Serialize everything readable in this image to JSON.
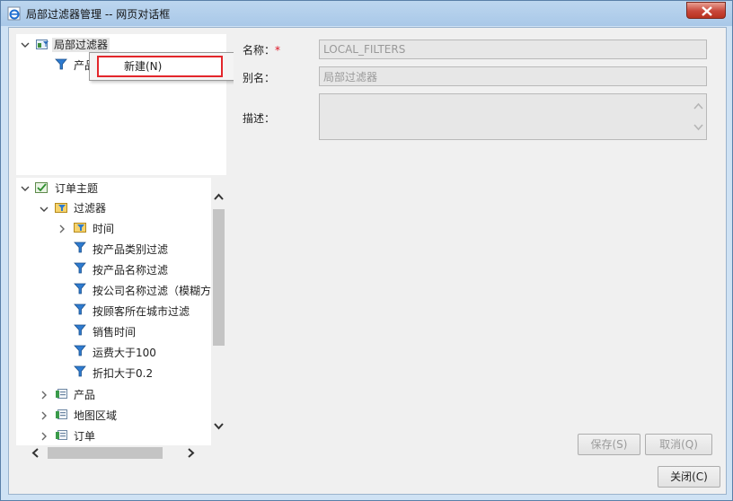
{
  "window": {
    "title": "局部过滤器管理 -- 网页对话框"
  },
  "top_tree": {
    "root_label": "局部过滤器",
    "child_label": "产品"
  },
  "context_menu": {
    "item_label": "新建(N)"
  },
  "bottom_tree": {
    "root_label": "订单主题",
    "filters_label": "过滤器",
    "items": [
      "时间",
      "按产品类别过滤",
      "按产品名称过滤",
      "按公司名称过滤（模糊方",
      "按顾客所在城市过滤",
      "销售时间",
      "运费大于100",
      "折扣大于0.2"
    ],
    "folders": [
      "产品",
      "地图区域",
      "订单"
    ]
  },
  "form": {
    "name_label": "名称：",
    "required_mark": "*",
    "name_value": "LOCAL_FILTERS",
    "alias_label": "别名：",
    "alias_value": "局部过滤器",
    "desc_label": "描述："
  },
  "buttons": {
    "save": "保存(S)",
    "cancel": "取消(Q)",
    "close": "关闭(C)"
  },
  "colors": {
    "title_bar": "#a9c8e8",
    "close_button": "#c8473a",
    "highlight_border": "#e3262b"
  }
}
